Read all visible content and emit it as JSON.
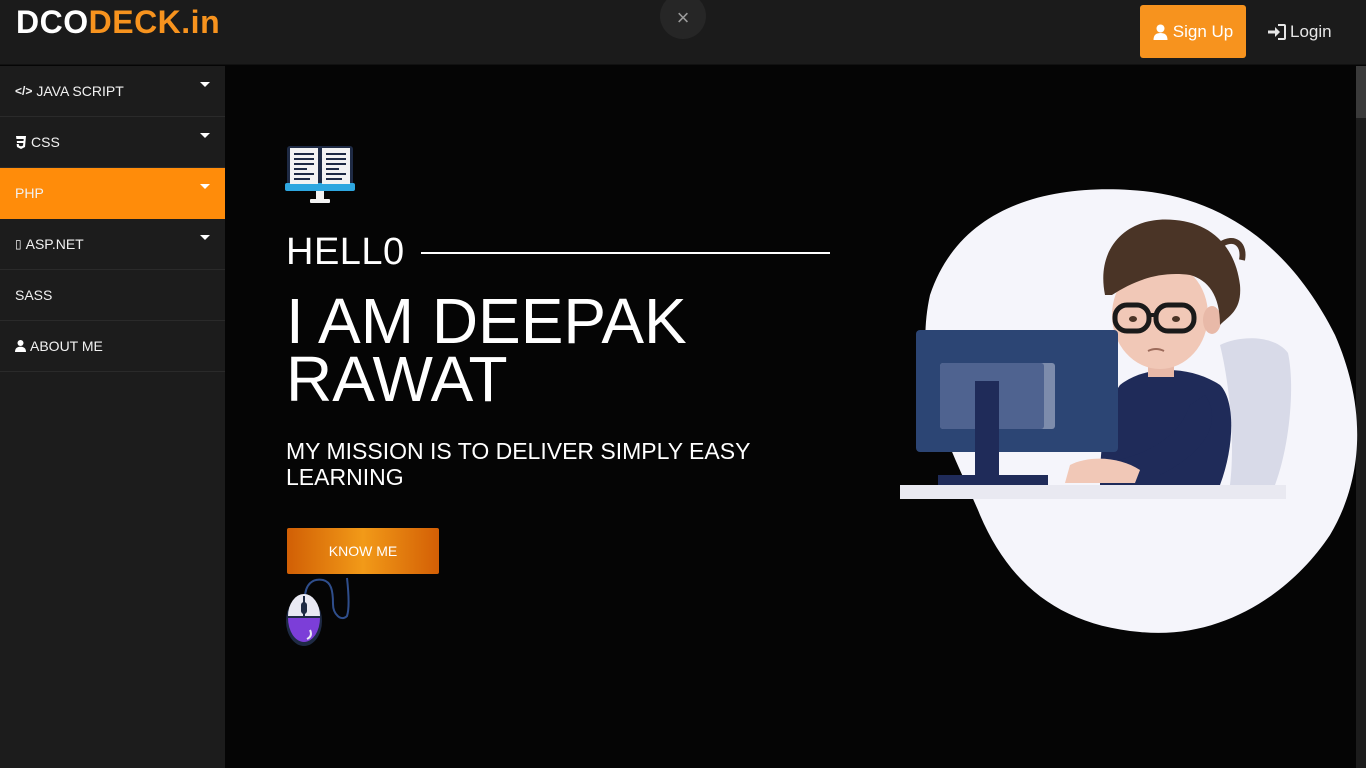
{
  "header": {
    "logo_part1": "DCO",
    "logo_part2": "DECK.in",
    "close_glyph": "×",
    "signup_label": "Sign Up",
    "login_label": "Login",
    "signup_icon": "user-icon",
    "login_icon": "sign-in-icon"
  },
  "sidebar": {
    "items": [
      {
        "label": "JAVA SCRIPT",
        "icon": "code-icon",
        "icon_glyph": "</>",
        "has_caret": true
      },
      {
        "label": "CSS",
        "icon": "css3-icon",
        "icon_glyph": "",
        "has_caret": true
      },
      {
        "label": "PHP",
        "icon": "",
        "icon_glyph": "",
        "has_caret": true,
        "active": true
      },
      {
        "label": "ASP.NET",
        "icon": "missing-glyph-icon",
        "icon_glyph": "▯",
        "has_caret": true
      },
      {
        "label": "SASS",
        "icon": "",
        "icon_glyph": "",
        "has_caret": false
      },
      {
        "label": "ABOUT ME",
        "icon": "user-icon",
        "icon_glyph": "",
        "has_caret": false
      }
    ]
  },
  "hero": {
    "hello": "HELL0",
    "name": "I AM DEEPAK RAWAT",
    "mission": "MY MISSION IS TO DELIVER SIMPLY EASY LEARNING",
    "button_label": "KNOW ME"
  },
  "colors": {
    "accent": "#f7931e",
    "active_nav": "#ff8c0a",
    "header_bg": "#1b1b1b",
    "sidebar_bg": "#1c1c1c",
    "main_bg": "#050505"
  }
}
